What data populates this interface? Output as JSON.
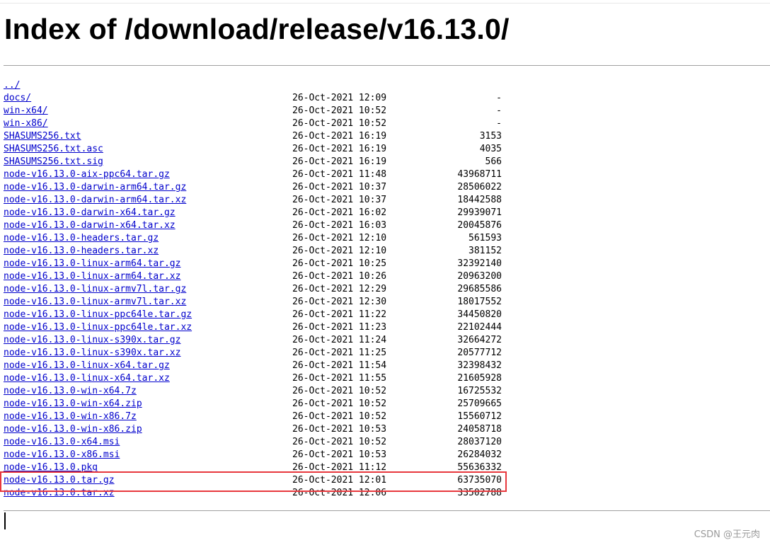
{
  "page": {
    "title": "Index of /download/release/v16.13.0/"
  },
  "watermark": "CSDN @王元肉",
  "colors": {
    "link": "#0000cc",
    "highlight_border": "#e8383d",
    "rule": "#a0a0a0"
  },
  "highlighted_entry": "node-v16.13.0.tar.gz",
  "entries": [
    {
      "name": "../",
      "date": "",
      "size": ""
    },
    {
      "name": "docs/",
      "date": "26-Oct-2021 12:09",
      "size": "-"
    },
    {
      "name": "win-x64/",
      "date": "26-Oct-2021 10:52",
      "size": "-"
    },
    {
      "name": "win-x86/",
      "date": "26-Oct-2021 10:52",
      "size": "-"
    },
    {
      "name": "SHASUMS256.txt",
      "date": "26-Oct-2021 16:19",
      "size": "3153"
    },
    {
      "name": "SHASUMS256.txt.asc",
      "date": "26-Oct-2021 16:19",
      "size": "4035"
    },
    {
      "name": "SHASUMS256.txt.sig",
      "date": "26-Oct-2021 16:19",
      "size": "566"
    },
    {
      "name": "node-v16.13.0-aix-ppc64.tar.gz",
      "date": "26-Oct-2021 11:48",
      "size": "43968711"
    },
    {
      "name": "node-v16.13.0-darwin-arm64.tar.gz",
      "date": "26-Oct-2021 10:37",
      "size": "28506022"
    },
    {
      "name": "node-v16.13.0-darwin-arm64.tar.xz",
      "date": "26-Oct-2021 10:37",
      "size": "18442588"
    },
    {
      "name": "node-v16.13.0-darwin-x64.tar.gz",
      "date": "26-Oct-2021 16:02",
      "size": "29939071"
    },
    {
      "name": "node-v16.13.0-darwin-x64.tar.xz",
      "date": "26-Oct-2021 16:03",
      "size": "20045876"
    },
    {
      "name": "node-v16.13.0-headers.tar.gz",
      "date": "26-Oct-2021 12:10",
      "size": "561593"
    },
    {
      "name": "node-v16.13.0-headers.tar.xz",
      "date": "26-Oct-2021 12:10",
      "size": "381152"
    },
    {
      "name": "node-v16.13.0-linux-arm64.tar.gz",
      "date": "26-Oct-2021 10:25",
      "size": "32392140"
    },
    {
      "name": "node-v16.13.0-linux-arm64.tar.xz",
      "date": "26-Oct-2021 10:26",
      "size": "20963200"
    },
    {
      "name": "node-v16.13.0-linux-armv7l.tar.gz",
      "date": "26-Oct-2021 12:29",
      "size": "29685586"
    },
    {
      "name": "node-v16.13.0-linux-armv7l.tar.xz",
      "date": "26-Oct-2021 12:30",
      "size": "18017552"
    },
    {
      "name": "node-v16.13.0-linux-ppc64le.tar.gz",
      "date": "26-Oct-2021 11:22",
      "size": "34450820"
    },
    {
      "name": "node-v16.13.0-linux-ppc64le.tar.xz",
      "date": "26-Oct-2021 11:23",
      "size": "22102444"
    },
    {
      "name": "node-v16.13.0-linux-s390x.tar.gz",
      "date": "26-Oct-2021 11:24",
      "size": "32664272"
    },
    {
      "name": "node-v16.13.0-linux-s390x.tar.xz",
      "date": "26-Oct-2021 11:25",
      "size": "20577712"
    },
    {
      "name": "node-v16.13.0-linux-x64.tar.gz",
      "date": "26-Oct-2021 11:54",
      "size": "32398432"
    },
    {
      "name": "node-v16.13.0-linux-x64.tar.xz",
      "date": "26-Oct-2021 11:55",
      "size": "21605928"
    },
    {
      "name": "node-v16.13.0-win-x64.7z",
      "date": "26-Oct-2021 10:52",
      "size": "16725532"
    },
    {
      "name": "node-v16.13.0-win-x64.zip",
      "date": "26-Oct-2021 10:52",
      "size": "25709665"
    },
    {
      "name": "node-v16.13.0-win-x86.7z",
      "date": "26-Oct-2021 10:52",
      "size": "15560712"
    },
    {
      "name": "node-v16.13.0-win-x86.zip",
      "date": "26-Oct-2021 10:53",
      "size": "24058718"
    },
    {
      "name": "node-v16.13.0-x64.msi",
      "date": "26-Oct-2021 10:52",
      "size": "28037120"
    },
    {
      "name": "node-v16.13.0-x86.msi",
      "date": "26-Oct-2021 10:53",
      "size": "26284032"
    },
    {
      "name": "node-v16.13.0.pkg",
      "date": "26-Oct-2021 11:12",
      "size": "55636332"
    },
    {
      "name": "node-v16.13.0.tar.gz",
      "date": "26-Oct-2021 12:01",
      "size": "63735070"
    },
    {
      "name": "node-v16.13.0.tar.xz",
      "date": "26-Oct-2021 12:06",
      "size": "33502788"
    }
  ]
}
